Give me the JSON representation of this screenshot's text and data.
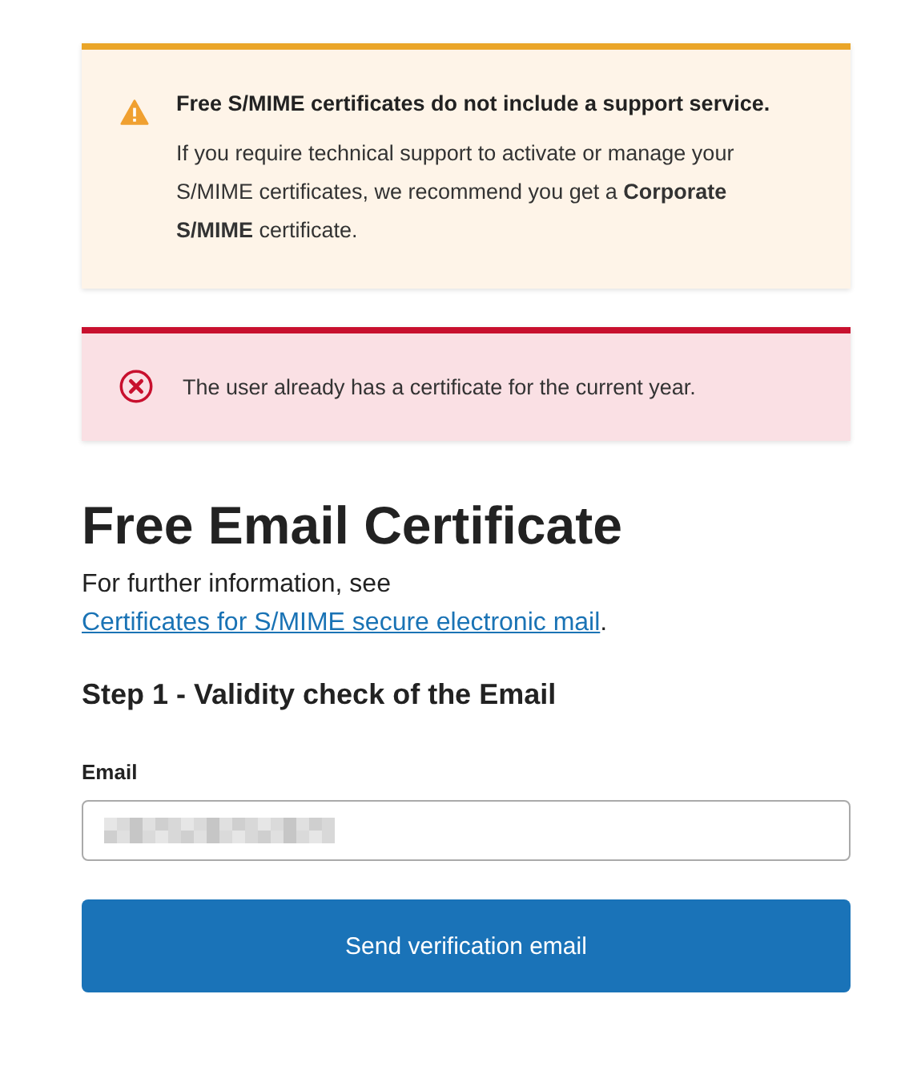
{
  "alerts": [
    {
      "kind": "warning",
      "title": "Free S/MIME certificates do not include a support service.",
      "body": "If you require technical support to activate or manage your S/MIME certificates, we recommend you get a **Corporate S/MIME** certificate."
    },
    {
      "kind": "error",
      "body": "The user already has a certificate for the current year."
    }
  ],
  "heading": "Free Email Certificate",
  "intro": {
    "text": "For further information, see ",
    "link": "Certificates for S/MIME secure electronic mail",
    "after": "."
  },
  "step": "Step 1 - Validity check of the Email",
  "field": {
    "label": "Email",
    "redacted": true
  },
  "button": "Send verification email"
}
